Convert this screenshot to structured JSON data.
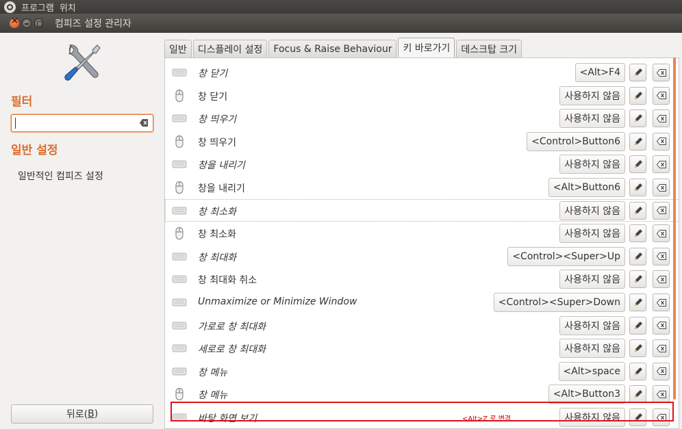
{
  "top_panel": {
    "menus": [
      "프로그램",
      "위치"
    ]
  },
  "window": {
    "title": "컴피즈 설정 관리자"
  },
  "sidebar": {
    "filter_heading": "필터",
    "filter_value": "",
    "general_heading": "일반 설정",
    "category": "일반적인 컴피즈 설정",
    "back_label": "뒤로(",
    "back_mnemonic": "B",
    "back_label_end": ")"
  },
  "tabs": [
    {
      "label": "일반",
      "active": false
    },
    {
      "label": "디스플레이 설정",
      "active": false
    },
    {
      "label": "Focus & Raise Behaviour",
      "active": false
    },
    {
      "label": "키 바로가기",
      "active": true
    },
    {
      "label": "데스크탑 크기",
      "active": false
    }
  ],
  "bindings": [
    {
      "icon": "keyboard-icon",
      "label": "창 닫기",
      "italic": true,
      "value": "<Alt>F4"
    },
    {
      "icon": "mouse-icon",
      "label": "창 닫기",
      "italic": false,
      "value": "사용하지 않음"
    },
    {
      "icon": "keyboard-icon",
      "label": "창 띄우기",
      "italic": true,
      "value": "사용하지 않음"
    },
    {
      "icon": "mouse-icon",
      "label": "창 띄우기",
      "italic": false,
      "value": "<Control>Button6"
    },
    {
      "icon": "keyboard-icon",
      "label": "창을 내리기",
      "italic": true,
      "value": "사용하지 않음"
    },
    {
      "icon": "mouse-icon",
      "label": "창을 내리기",
      "italic": false,
      "value": "<Alt>Button6"
    },
    {
      "icon": "keyboard-icon",
      "label": "창 최소화",
      "italic": true,
      "value": "사용하지 않음"
    },
    {
      "icon": "mouse-icon",
      "label": "창 최소화",
      "italic": false,
      "value": "사용하지 않음"
    },
    {
      "icon": "keyboard-icon",
      "label": "창 최대화",
      "italic": true,
      "value": "<Control><Super>Up"
    },
    {
      "icon": "keyboard-icon",
      "label": "창 최대화 취소",
      "italic": false,
      "value": "사용하지 않음"
    },
    {
      "icon": "keyboard-icon",
      "label": "Unmaximize or Minimize Window",
      "italic": true,
      "value": "<Control><Super>Down"
    },
    {
      "icon": "keyboard-icon",
      "label": "가로로 창 최대화",
      "italic": true,
      "value": "사용하지 않음"
    },
    {
      "icon": "keyboard-icon",
      "label": "세로로 창 최대화",
      "italic": true,
      "value": "사용하지 않음"
    },
    {
      "icon": "keyboard-icon",
      "label": "창 메뉴",
      "italic": true,
      "value": "<Alt>space"
    },
    {
      "icon": "mouse-icon",
      "label": "창 메뉴",
      "italic": true,
      "value": "<Alt>Button3"
    },
    {
      "icon": "keyboard-icon",
      "label": "바탕 화면 보기",
      "italic": true,
      "value": "사용하지 않음",
      "note": "<Alt>Z 로 변경"
    }
  ],
  "colors": {
    "accent": "#dd6c2c",
    "annotation": "#e0101a"
  }
}
